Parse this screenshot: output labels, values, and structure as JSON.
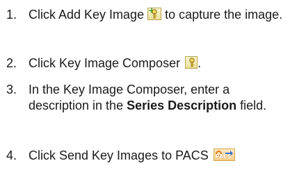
{
  "steps": [
    {
      "number": "1.",
      "before_icon": "Click Add Key Image",
      "icon": "add-key-image-icon",
      "after_icon": " to capture the image."
    },
    {
      "number": "2.",
      "before_icon": "Click Key Image Composer",
      "icon": "key-image-composer-icon",
      "after_icon": "."
    },
    {
      "number": "3.",
      "before_bold": "In the Key Image Composer, enter a description in the ",
      "bold": "Series Description",
      "after_bold": " field."
    },
    {
      "number": "4.",
      "before_icon": "Click Send Key Images to PACS",
      "icon": "send-key-images-to-pacs-icon",
      "icon_text": "PACS",
      "after_icon": ""
    }
  ],
  "colors": {
    "text": "#1a1a1a",
    "icon_border": "#b9a24a",
    "icon_fill": "#eadf9c",
    "plus_green": "#2e9b2e",
    "send_orange": "#e07a10"
  }
}
